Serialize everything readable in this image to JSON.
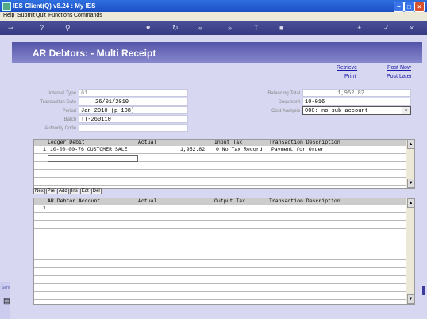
{
  "window": {
    "title": "IES Client(Q) v8.24 : My IES"
  },
  "menu": {
    "items": [
      "Help",
      "Submit",
      "Quit",
      "Functions",
      "Commands"
    ]
  },
  "toolbar": {
    "icons": [
      "key-icon",
      "help-icon",
      "search-icon",
      "heart-icon",
      "refresh-icon",
      "rewind-icon",
      "forward-icon",
      "text-icon",
      "stop-icon",
      "add-icon",
      "check-icon",
      "close-icon"
    ]
  },
  "page": {
    "title": "AR Debtors: - Multi Receipt"
  },
  "links": {
    "retrieve": "Retrieve",
    "print": "Print",
    "post_now": "Post Now",
    "post_later": "Post Later"
  },
  "form_left": [
    {
      "label": "Internal Type",
      "value": "61",
      "name": "internal-type"
    },
    {
      "label": "Transaction Date",
      "value": "26/01/2010",
      "name": "transaction-date"
    },
    {
      "label": "Period",
      "value": "Jan 2010 (p 108)",
      "name": "period"
    },
    {
      "label": "Batch",
      "value": "TT-260110",
      "name": "batch"
    },
    {
      "label": "Authority Code",
      "value": "",
      "name": "authority-code"
    }
  ],
  "form_right": [
    {
      "label": "Balancing Total",
      "value": "1,952.82",
      "name": "balancing-total"
    },
    {
      "label": "Document",
      "value": "10-016",
      "name": "document"
    },
    {
      "label": "Cost Analysis",
      "value": "000: no sub account",
      "name": "cost-analysis"
    }
  ],
  "grid_top": {
    "headers": [
      "Ledger Debit",
      "Actual",
      "Input Tax",
      "Transaction Description"
    ],
    "rows": [
      {
        "num": "1",
        "ledger": "10-00-00-76 CUSTOMER SALE",
        "actual": "1,952.82",
        "tax": "0 No Tax Record",
        "desc": "Payment for Order"
      }
    ]
  },
  "grid_buttons": [
    "Nex",
    "Pre",
    "Add",
    "Ins",
    "Edt",
    "Del"
  ],
  "grid_bottom": {
    "headers": [
      "AR Debtor Account",
      "Actual",
      "Output Tax",
      "Transaction Description"
    ],
    "rows": [
      {
        "num": "1"
      }
    ]
  },
  "sidebar": {
    "label": "Serv"
  }
}
